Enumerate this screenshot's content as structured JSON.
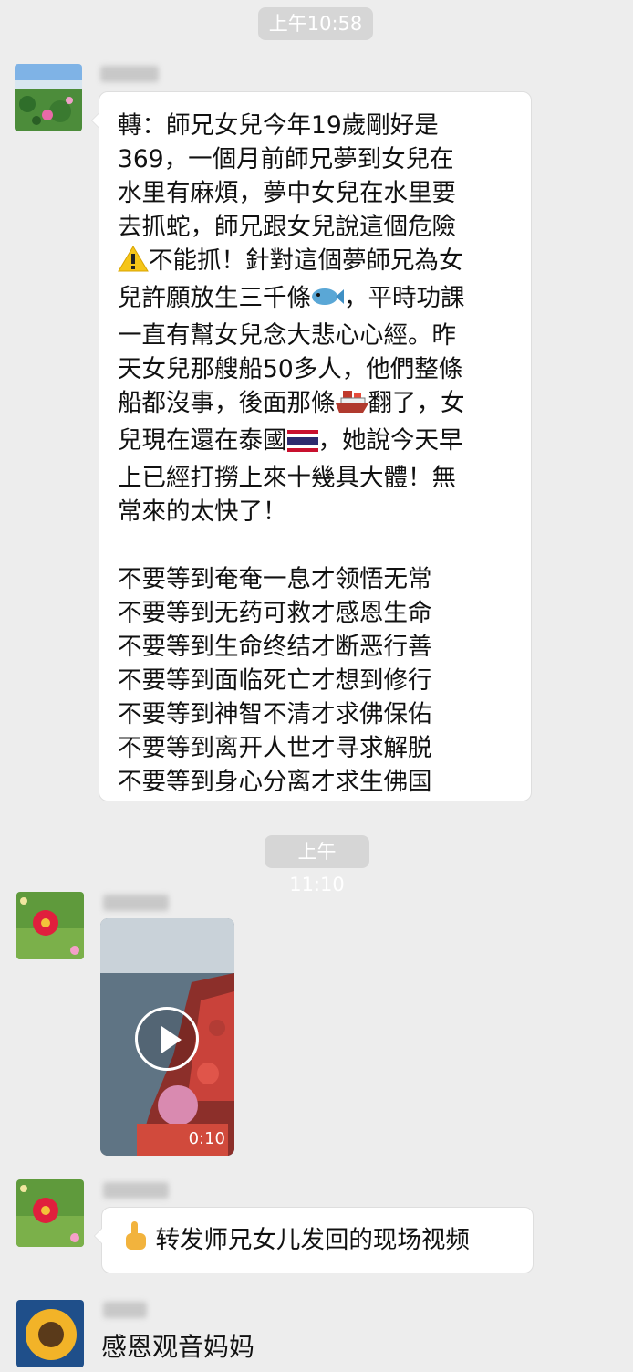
{
  "timestamps": [
    "上午10:58",
    "上午11:10"
  ],
  "messages": [
    {
      "avatar": "lotus-pond-avatar",
      "lines": [
        "轉：師兄女兒今年19歲剛好是",
        "369，一個月前師兄夢到女兒在",
        "水里有麻煩，夢中女兒在水里要",
        "去抓蛇，師兄跟女兒說這個危險",
        "不能抓！針對這個夢師兄為女",
        "兒許願放生三千條",
        "，平時功課",
        "一直有幫女兒念大悲心心經。昨",
        "天女兒那艘船50多人，他們整條",
        "船都沒事，後面那條",
        "翻了，女",
        "兒現在還在泰國",
        "，她說今天早",
        "上已經打撈上來十幾具大體！無",
        "常來的太快了！"
      ],
      "verses": [
        "不要等到奄奄一息才领悟无常",
        "不要等到无药可救才感恩生命",
        "不要等到生命终结才断恶行善",
        "不要等到面临死亡才想到修行",
        "不要等到神智不清才求佛保佑",
        "不要等到离开人世才寻求解脱",
        "不要等到身心分离才求生佛国"
      ]
    },
    {
      "avatar": "flower-avatar",
      "video_duration": "0:10"
    },
    {
      "avatar": "flower-avatar",
      "text": "转发师兄女儿发回的现场视频"
    },
    {
      "avatar": "sunflower-avatar",
      "text": "感恩观音妈妈"
    }
  ]
}
